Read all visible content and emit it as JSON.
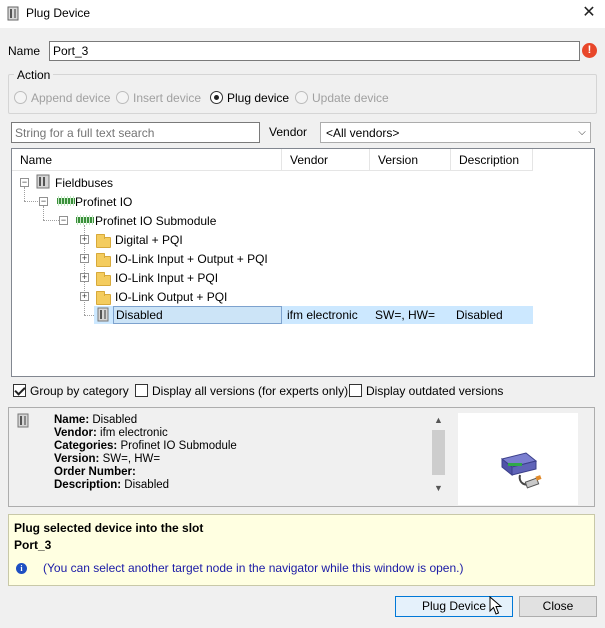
{
  "window": {
    "title": "Plug Device",
    "close_glyph": "✕"
  },
  "name_row": {
    "label": "Name",
    "value": "Port_3",
    "error_glyph": "!"
  },
  "action": {
    "legend": "Action",
    "options": [
      {
        "label": "Append device",
        "selected": false,
        "enabled": false
      },
      {
        "label": "Insert device",
        "selected": false,
        "enabled": false
      },
      {
        "label": "Plug device",
        "selected": true,
        "enabled": true
      },
      {
        "label": "Update device",
        "selected": false,
        "enabled": false
      }
    ]
  },
  "search": {
    "placeholder": "String for a full text search",
    "vendor_label": "Vendor",
    "vendor_value": "<All vendors>"
  },
  "tree": {
    "columns": [
      "Name",
      "Vendor",
      "Version",
      "Description"
    ],
    "nodes": [
      {
        "label": "Fieldbuses",
        "icon": "fieldbus-icon",
        "expander": "⊟"
      },
      {
        "label": "Profinet IO",
        "icon": "profinet-icon",
        "expander": "⊟"
      },
      {
        "label": "Profinet IO Submodule",
        "icon": "profinet-icon",
        "expander": "⊟"
      },
      {
        "label": "Digital + PQI",
        "icon": "folder-icon",
        "expander": "+"
      },
      {
        "label": "IO-Link Input + Output + PQI",
        "icon": "folder-icon",
        "expander": "+"
      },
      {
        "label": "IO-Link Input + PQI",
        "icon": "folder-icon",
        "expander": "+"
      },
      {
        "label": "IO-Link Output + PQI",
        "icon": "folder-icon",
        "expander": "+"
      }
    ],
    "selected": {
      "name": "Disabled",
      "vendor": "ifm electronic",
      "version": "SW=, HW=",
      "description": "Disabled"
    }
  },
  "options": {
    "group_by_category": {
      "label": "Group by category",
      "checked": true
    },
    "display_all_versions": {
      "label": "Display all versions (for experts only)",
      "checked": false
    },
    "display_outdated": {
      "label": "Display outdated versions",
      "checked": false
    }
  },
  "info": {
    "name_key": "Name:",
    "name_val": "Disabled",
    "vendor_key": "Vendor:",
    "vendor_val": "ifm electronic",
    "categories_key": "Categories:",
    "categories_val": "Profinet IO Submodule",
    "version_key": "Version:",
    "version_val": "SW=, HW=",
    "order_key": "Order Number:",
    "order_val": "",
    "description_key": "Description:",
    "description_val": "Disabled"
  },
  "message": {
    "line1": "Plug selected device into the slot",
    "line2": "Port_3",
    "note": "(You can select another target node in the navigator while this window is open.)"
  },
  "buttons": {
    "plug": "Plug Device",
    "close": "Close"
  },
  "colors": {
    "selection": "#cce8ff",
    "message_bg": "#ffffe1",
    "note_text": "#1a1aa6",
    "error": "#e8472a"
  }
}
